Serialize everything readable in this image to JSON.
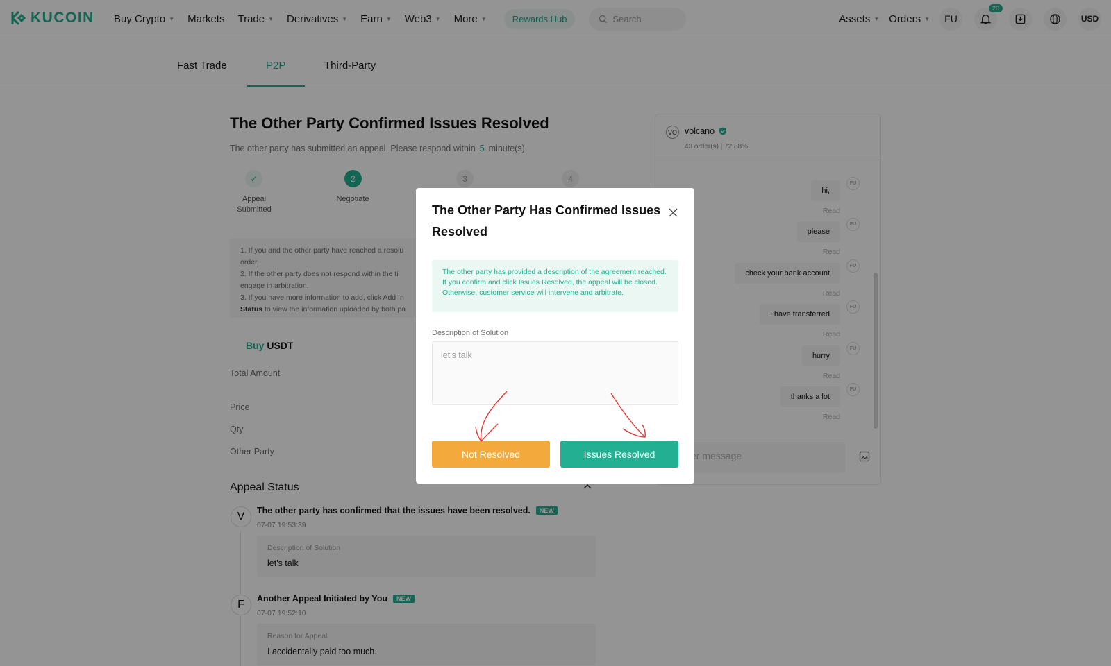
{
  "nav": {
    "logo": "KUCOIN",
    "items": [
      {
        "label": "Buy Crypto",
        "caret": true
      },
      {
        "label": "Markets",
        "caret": false
      },
      {
        "label": "Trade",
        "caret": true
      },
      {
        "label": "Derivatives",
        "caret": true
      },
      {
        "label": "Earn",
        "caret": true
      },
      {
        "label": "Web3",
        "caret": true
      },
      {
        "label": "More",
        "caret": true
      }
    ],
    "rewards": "Rewards Hub",
    "search_placeholder": "Search",
    "assets": "Assets",
    "orders": "Orders",
    "user": "FU",
    "notif_count": "20",
    "currency": "USD"
  },
  "tabs": [
    "Fast Trade",
    "P2P",
    "Third-Party"
  ],
  "main": {
    "title": "The Other Party Confirmed Issues Resolved",
    "subtitle_pre": "The other party has submitted an appeal. Please respond within",
    "subtitle_num": "5",
    "subtitle_post": "minute(s).",
    "steps": [
      {
        "num": "✓",
        "label": "Appeal Submitted"
      },
      {
        "num": "2",
        "label": "Negotiate"
      },
      {
        "num": "3",
        "label": ""
      },
      {
        "num": "4",
        "label": ""
      }
    ],
    "notice": [
      "1. If you and the other party have reached a resolu",
      "order.",
      "2. If the other party does not respond within the ti",
      "engage in arbitration.",
      "3. If you have more information to add, click Add In"
    ],
    "notice_status_bold": "Status",
    "notice_status_rest": " to view the information uploaded by both pa",
    "buy_word": "Buy",
    "buy_asset": "USDT",
    "rows": [
      "Total Amount",
      "Price",
      "Qty",
      "Other Party"
    ],
    "appeal_title": "Appeal Status",
    "events": [
      {
        "avatar": "V",
        "title": "The other party has confirmed that the issues have been resolved.",
        "badge": "NEW",
        "time": "07-07 19:53:39",
        "key": "Description of Solution",
        "value": "let's talk"
      },
      {
        "avatar": "F",
        "title": "Another Appeal Initiated by You",
        "badge": "NEW",
        "time": "07-07 19:52:10",
        "key": "Reason for Appeal",
        "value": "I accidentally paid too much."
      }
    ]
  },
  "chat": {
    "avatar": "VO",
    "username": "volcano",
    "stats": "43 order(s)  |  72.88%",
    "messages": [
      "hi,",
      "please",
      "check your bank account",
      "i have transferred",
      "hurry",
      "thanks a lot"
    ],
    "read_label": "Read",
    "sender": "FU",
    "input_placeholder": "Enter message"
  },
  "modal": {
    "title": "The Other Party Has Confirmed Issues Resolved",
    "info": "The other party has provided a description of the agreement reached. If you confirm and click Issues Resolved, the appeal will be closed. Otherwise, customer service will intervene and arbitrate.",
    "desc_label": "Description of Solution",
    "desc_value": "let's talk",
    "btn_not": "Not Resolved",
    "btn_yes": "Issues Resolved"
  },
  "colors": {
    "accent": "#23af91",
    "warning": "#f3a93b",
    "annotation": "#e53935"
  }
}
